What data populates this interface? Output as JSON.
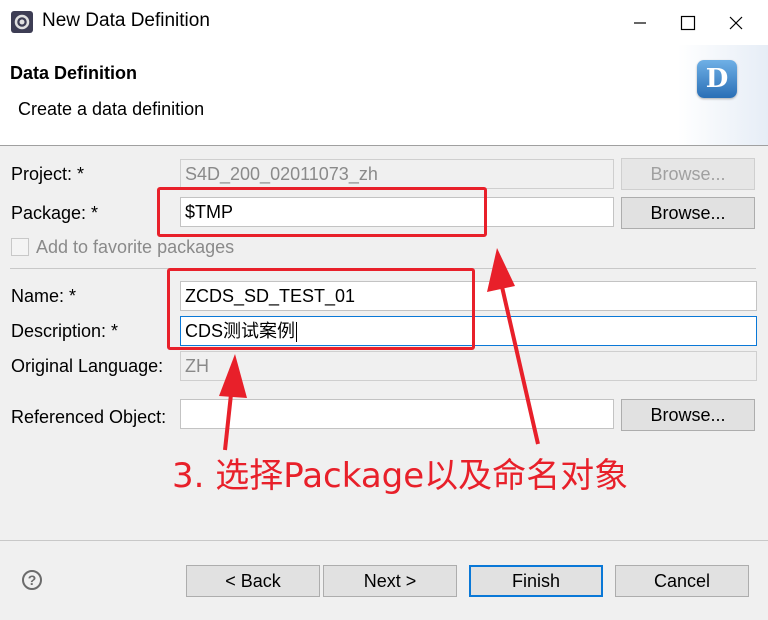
{
  "window": {
    "title": "New Data Definition"
  },
  "banner": {
    "title": "Data Definition",
    "subtitle": "Create a data definition",
    "logo_letter": "D"
  },
  "form": {
    "project": {
      "label": "Project: *",
      "value": "S4D_200_02011073_zh",
      "browse": "Browse..."
    },
    "package": {
      "label": "Package: *",
      "value": "$TMP",
      "browse": "Browse..."
    },
    "favorite": {
      "label": "Add to favorite packages"
    },
    "name": {
      "label": "Name: *",
      "value": "ZCDS_SD_TEST_01"
    },
    "description": {
      "label": "Description: *",
      "value": "CDS测试案例"
    },
    "language": {
      "label": "Original Language:",
      "value": "ZH"
    },
    "referenced": {
      "label": "Referenced Object:",
      "value": "",
      "browse": "Browse..."
    }
  },
  "footer": {
    "back": "< Back",
    "next": "Next >",
    "finish": "Finish",
    "cancel": "Cancel",
    "help": "?"
  },
  "annotation": {
    "text": "3. 选择Package以及命名对象",
    "color": "#e8202a"
  },
  "colors": {
    "accent": "#0a78d7",
    "annotation": "#e8202a"
  },
  "icons": [
    "app-icon",
    "minimize-icon",
    "maximize-icon",
    "close-icon",
    "help-icon",
    "data-definition-logo"
  ]
}
